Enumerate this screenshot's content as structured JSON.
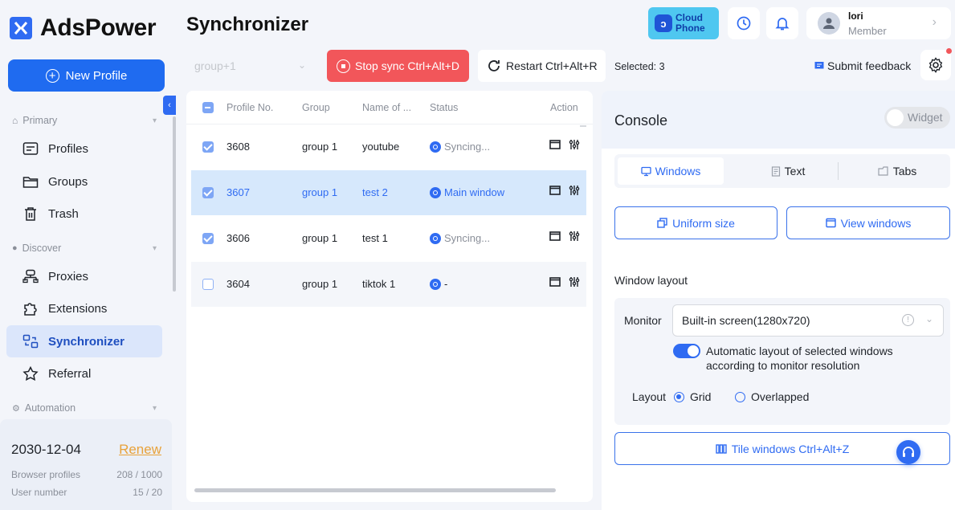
{
  "app": {
    "name": "AdsPower"
  },
  "sidebar": {
    "new_profile_label": "New Profile",
    "sections": {
      "primary": "Primary",
      "discover": "Discover",
      "automation": "Automation"
    },
    "items": [
      {
        "label": "Profiles",
        "icon": "profiles-icon"
      },
      {
        "label": "Groups",
        "icon": "folder-icon"
      },
      {
        "label": "Trash",
        "icon": "trash-icon"
      },
      {
        "label": "Proxies",
        "icon": "proxies-icon"
      },
      {
        "label": "Extensions",
        "icon": "puzzle-icon"
      },
      {
        "label": "Synchronizer",
        "icon": "synchronizer-icon",
        "active": true
      },
      {
        "label": "Referral",
        "icon": "referral-icon"
      }
    ],
    "plan": {
      "date": "2030-12-04",
      "renew_label": "Renew",
      "browser_profiles_label": "Browser profiles",
      "browser_profiles_value": "208 / 1000",
      "user_number_label": "User number",
      "user_number_value": "15 / 20"
    }
  },
  "header": {
    "title": "Synchronizer",
    "cloud_phone_line1": "Cloud",
    "cloud_phone_line2": "Phone",
    "user": {
      "name": "lori",
      "role": "Member"
    }
  },
  "toolbar": {
    "group_placeholder": "group+1",
    "stop_label": "Stop sync Ctrl+Alt+D",
    "restart_label": "Restart Ctrl+Alt+R",
    "selected_text": "Selected: 3",
    "feedback_label": "Submit feedback"
  },
  "table": {
    "columns": [
      "Profile No.",
      "Group",
      "Name of ...",
      "Status",
      "Action"
    ],
    "rows": [
      {
        "no": "3608",
        "group": "group 1",
        "name": "youtube",
        "status": "Syncing...",
        "checked": true
      },
      {
        "no": "3607",
        "group": "group 1",
        "name": "test 2",
        "status": "Main window",
        "checked": true
      },
      {
        "no": "3606",
        "group": "group 1",
        "name": "test 1",
        "status": "Syncing...",
        "checked": true
      },
      {
        "no": "3604",
        "group": "group 1",
        "name": "tiktok 1",
        "status": "-",
        "checked": false
      }
    ]
  },
  "console": {
    "title": "Console",
    "widget_label": "Widget",
    "tabs": [
      "Windows",
      "Text",
      "Tabs"
    ],
    "uniform_size_label": "Uniform size",
    "view_windows_label": "View windows",
    "window_layout_label": "Window layout",
    "monitor_label": "Monitor",
    "monitor_value": "Built-in screen(1280x720)",
    "auto_layout_text": "Automatic layout of selected windows according to monitor resolution",
    "layout_label": "Layout",
    "layout_options": [
      "Grid",
      "Overlapped"
    ],
    "tile_label": "Tile windows Ctrl+Alt+Z"
  },
  "colors": {
    "accent": "#2f6bf2",
    "stop": "#f2565a",
    "renew": "#e8a23a",
    "cloud_phone": "#4fc7f0"
  }
}
